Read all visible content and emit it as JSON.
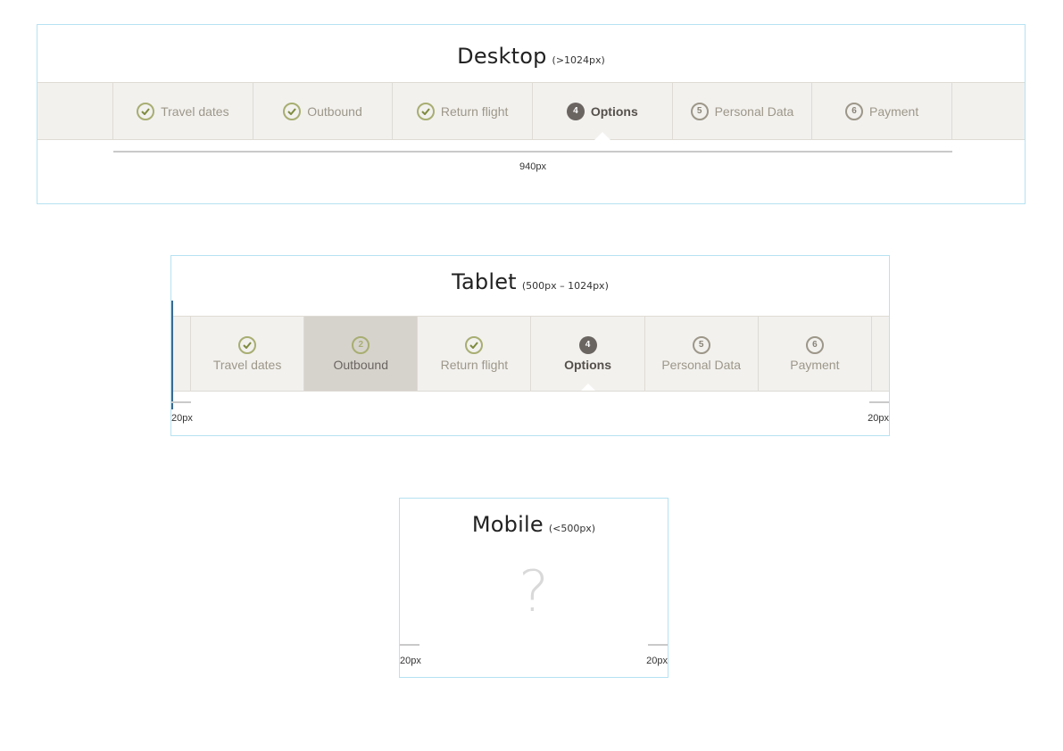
{
  "desktop": {
    "title": "Desktop",
    "range": "(>1024px)",
    "width_label": "940px",
    "steps": [
      {
        "label": "Travel dates",
        "state": "done"
      },
      {
        "label": "Outbound",
        "state": "done"
      },
      {
        "label": "Return flight",
        "state": "done"
      },
      {
        "label": "Options",
        "state": "current",
        "number": "4"
      },
      {
        "label": "Personal Data",
        "state": "todo",
        "number": "5"
      },
      {
        "label": "Payment",
        "state": "todo",
        "number": "6"
      }
    ]
  },
  "tablet": {
    "title": "Tablet",
    "range": "(500px – 1024px)",
    "left_gap_label": "20px",
    "right_gap_label": "20px",
    "steps": [
      {
        "label": "Travel dates",
        "state": "done"
      },
      {
        "label": "Outbound",
        "state": "active",
        "number": "2"
      },
      {
        "label": "Return flight",
        "state": "done"
      },
      {
        "label": "Options",
        "state": "current",
        "number": "4"
      },
      {
        "label": "Personal Data",
        "state": "todo",
        "number": "5"
      },
      {
        "label": "Payment",
        "state": "todo",
        "number": "6"
      }
    ]
  },
  "mobile": {
    "title": "Mobile",
    "range": "(<500px)",
    "placeholder": "?",
    "left_gap_label": "20px",
    "right_gap_label": "20px"
  },
  "colors": {
    "frame_border": "#b5e2f2",
    "bar_bg": "#f2f1ee",
    "done_green": "#a8ae72",
    "current_dark": "#6b6561",
    "active_bg": "#d6d3cc"
  }
}
